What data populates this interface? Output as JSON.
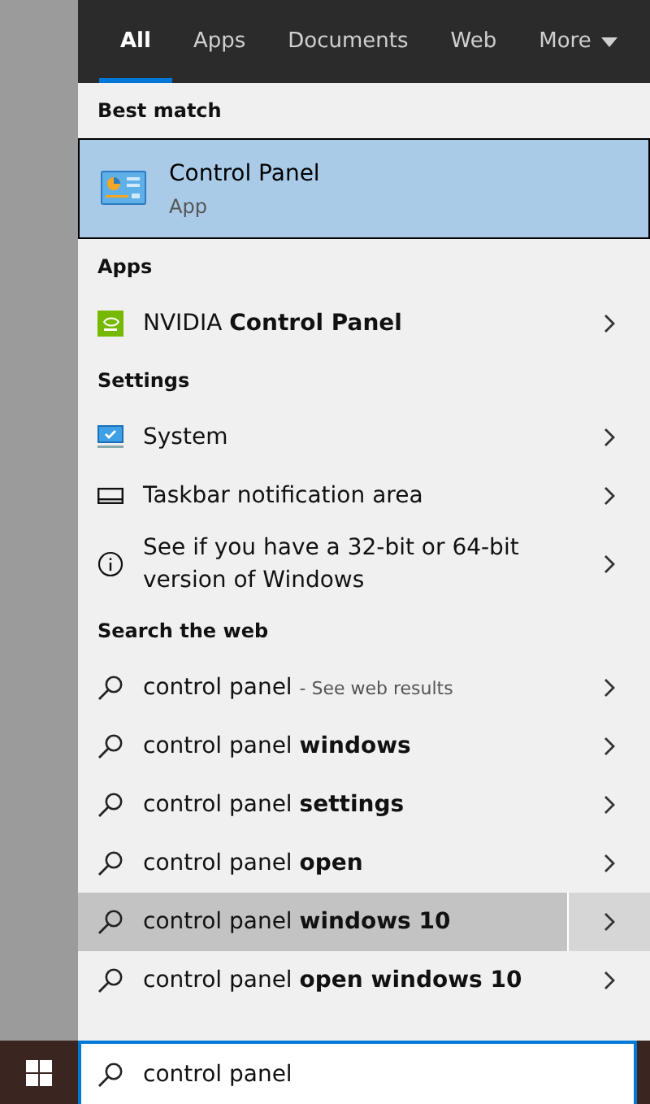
{
  "tabs": [
    {
      "label": "All",
      "selected": true,
      "dropdown": false
    },
    {
      "label": "Apps",
      "selected": false,
      "dropdown": false
    },
    {
      "label": "Documents",
      "selected": false,
      "dropdown": false
    },
    {
      "label": "Web",
      "selected": false,
      "dropdown": false
    },
    {
      "label": "More",
      "selected": false,
      "dropdown": true
    }
  ],
  "best_match": {
    "heading": "Best match",
    "title": "Control Panel",
    "subtitle": "App",
    "selected": true
  },
  "sections": [
    {
      "heading": "Apps",
      "items": [
        {
          "kind": "nvidia",
          "label": "NVIDIA **Control Panel**"
        }
      ]
    },
    {
      "heading": "Settings",
      "items": [
        {
          "kind": "system",
          "label": "System"
        },
        {
          "kind": "taskbar",
          "label": "Taskbar notification area"
        },
        {
          "kind": "info",
          "label": "See if you have a 32-bit or 64-bit version of Windows"
        }
      ]
    }
  ],
  "web": {
    "heading": "Search the web",
    "items": [
      {
        "label": "control panel",
        "hint": "- See web results",
        "highlighted": false
      },
      {
        "label": "control panel **windows**",
        "highlighted": false
      },
      {
        "label": "control panel **settings**",
        "highlighted": false
      },
      {
        "label": "control panel **open**",
        "highlighted": false
      },
      {
        "label": "control panel **windows 10**",
        "highlighted": true
      },
      {
        "label": "control panel **open windows 10**",
        "highlighted": false
      }
    ]
  },
  "search_box": {
    "value": "control panel"
  }
}
